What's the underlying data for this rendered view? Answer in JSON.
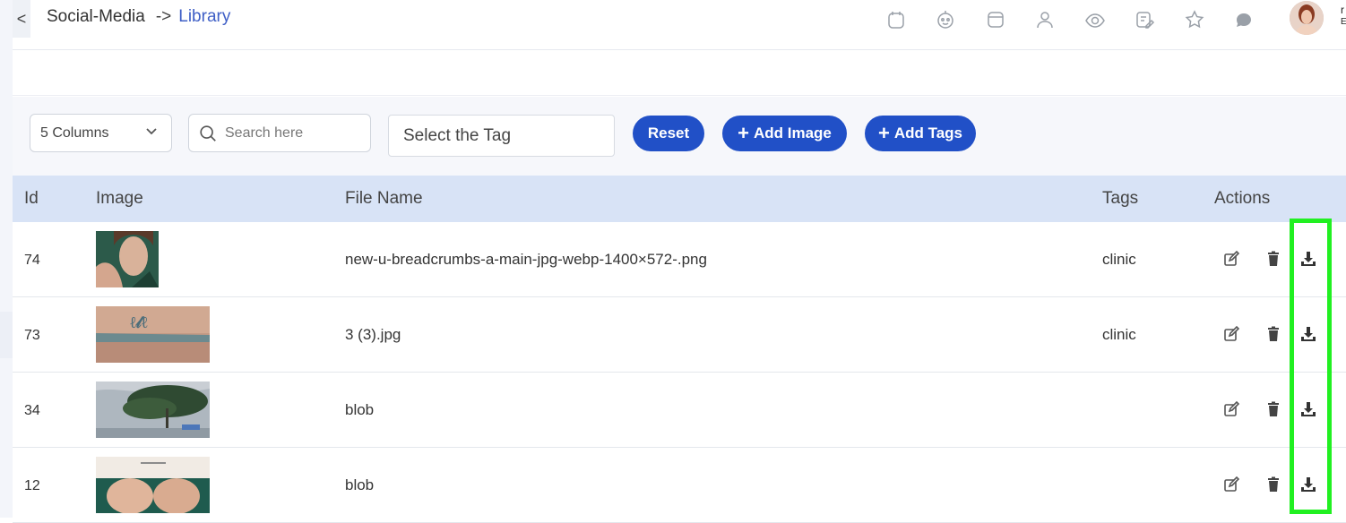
{
  "header": {
    "back_glyph": "<",
    "breadcrumb_root": "Social-Media",
    "breadcrumb_arrow": "->",
    "breadcrumb_current": "Library",
    "user_initial": "r",
    "user_sub": "E",
    "icons": [
      "calendar-icon",
      "robot-icon",
      "window-icon",
      "user-icon",
      "eye-share-icon",
      "edit-note-icon",
      "star-icon",
      "chat-icon"
    ]
  },
  "toolbar": {
    "columns_select": "5 Columns",
    "search_placeholder": "Search here",
    "tag_select": "Select the Tag",
    "reset_label": "Reset",
    "add_image_label": "Add Image",
    "add_tags_label": "Add Tags",
    "accent_color": "#2150c7"
  },
  "table": {
    "headers": {
      "id": "Id",
      "image": "Image",
      "file_name": "File Name",
      "tags": "Tags",
      "actions": "Actions"
    },
    "rows": [
      {
        "id": "74",
        "image": "woman-portrait-thumbnail",
        "file_name": "new-u-breadcrumbs-a-main-jpg-webp-1400×572-.png",
        "tags": "clinic"
      },
      {
        "id": "73",
        "image": "tattoo-arm-thumbnail",
        "file_name": "3 (3).jpg",
        "tags": "clinic"
      },
      {
        "id": "34",
        "image": "tree-sky-thumbnail",
        "file_name": "blob",
        "tags": ""
      },
      {
        "id": "12",
        "image": "neck-treatment-thumbnail",
        "file_name": "blob",
        "tags": ""
      }
    ],
    "row_actions": [
      "edit-icon",
      "trash-icon",
      "download-icon"
    ]
  },
  "highlight": {
    "target": "download-column",
    "color": "#21f021"
  }
}
